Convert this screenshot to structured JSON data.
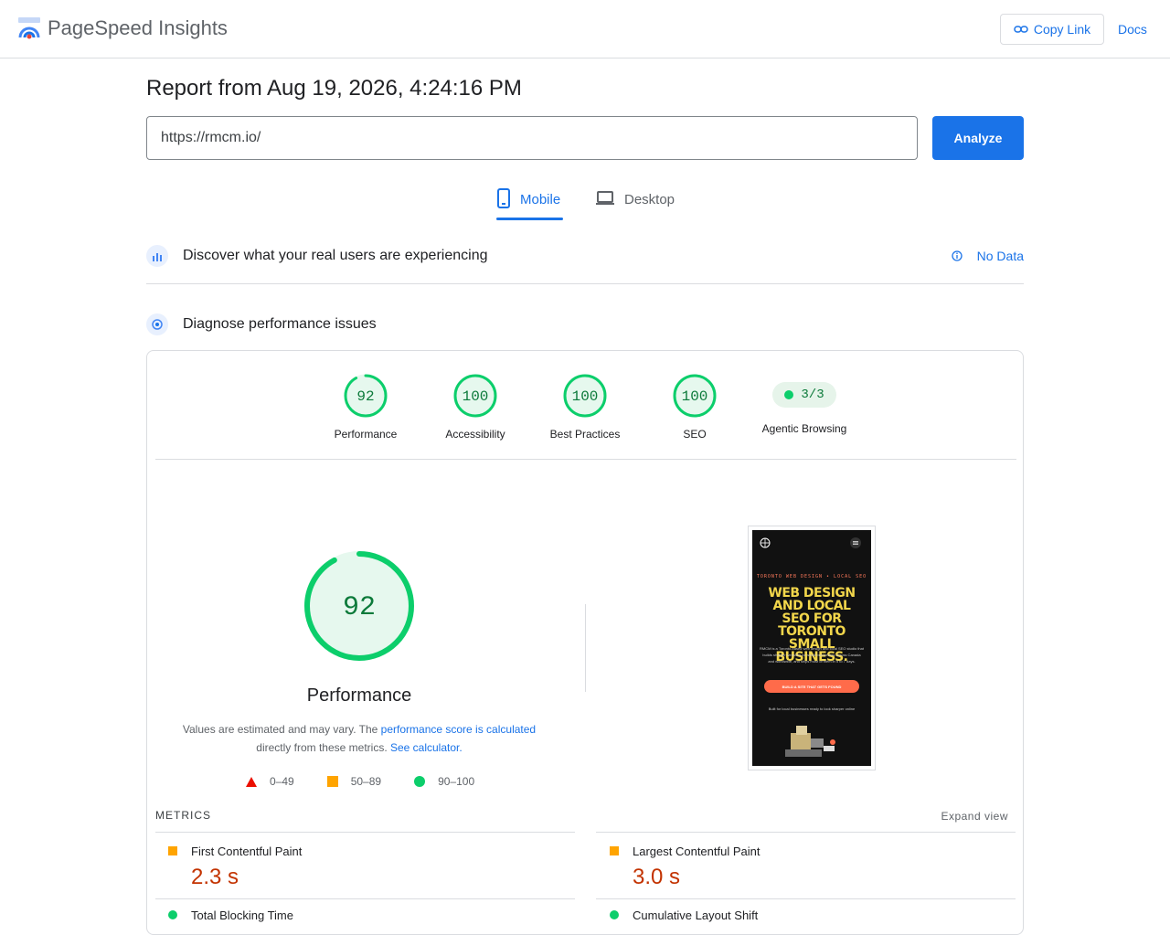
{
  "app": {
    "name": "PageSpeed Insights"
  },
  "header": {
    "copy_link_label": "Copy Link",
    "docs_label": "Docs"
  },
  "report": {
    "title": "Report from Aug 19, 2026, 4:24:16 PM",
    "url_value": "https://rmcm.io/",
    "analyze_label": "Analyze"
  },
  "tabs": [
    {
      "label": "Mobile",
      "active": true,
      "icon": "phone-icon"
    },
    {
      "label": "Desktop",
      "active": false,
      "icon": "laptop-icon"
    }
  ],
  "sections": {
    "field": {
      "title": "Discover what your real users are experiencing",
      "status": "No Data"
    },
    "lab": {
      "title": "Diagnose performance issues"
    }
  },
  "scores": [
    {
      "label": "Performance",
      "value": "92",
      "score": 92
    },
    {
      "label": "Accessibility",
      "value": "100",
      "score": 100
    },
    {
      "label": "Best Practices",
      "value": "100",
      "score": 100
    },
    {
      "label": "SEO",
      "value": "100",
      "score": 100
    },
    {
      "label": "Agentic Browsing",
      "value": "3/3"
    }
  ],
  "performance": {
    "score": "92",
    "title": "Performance",
    "note_prefix": "Values are estimated and may vary. The ",
    "note_link1": "performance score is calculated",
    "note_mid": " directly from these metrics. ",
    "note_link2": "See calculator."
  },
  "legend": [
    {
      "label": "0–49",
      "color": "#eb0f00"
    },
    {
      "label": "50–89",
      "color": "#ffa400"
    },
    {
      "label": "90–100",
      "color": "#0cce6b"
    }
  ],
  "preview": {
    "eyebrow": "TORONTO WEB DESIGN • LOCAL SEO",
    "headline": "WEB DESIGN AND LOCAL SEO FOR TORONTO SMALL BUSINESS.",
    "body": "RMCM is a Toronto-based web design and local SEO studio that builds sharper websites for small businesses across Canada and worldwide, and ships most of them in 5 to 7 days.",
    "cta": "BUILD A SITE THAT GETS FOUND",
    "sub": "Built for local businesses ready to look sharper online"
  },
  "metrics": {
    "header": "METRICS",
    "expand_label": "Expand view",
    "items": [
      {
        "name": "First Contentful Paint",
        "value": "2.3 s",
        "rating": "average"
      },
      {
        "name": "Largest Contentful Paint",
        "value": "3.0 s",
        "rating": "average"
      },
      {
        "name": "Total Blocking Time",
        "rating": "good"
      },
      {
        "name": "Cumulative Layout Shift",
        "rating": "good"
      }
    ]
  },
  "colors": {
    "accent": "#1a73e8",
    "good": "#0cce6b",
    "average": "#ffa400",
    "poor": "#eb0f00"
  }
}
